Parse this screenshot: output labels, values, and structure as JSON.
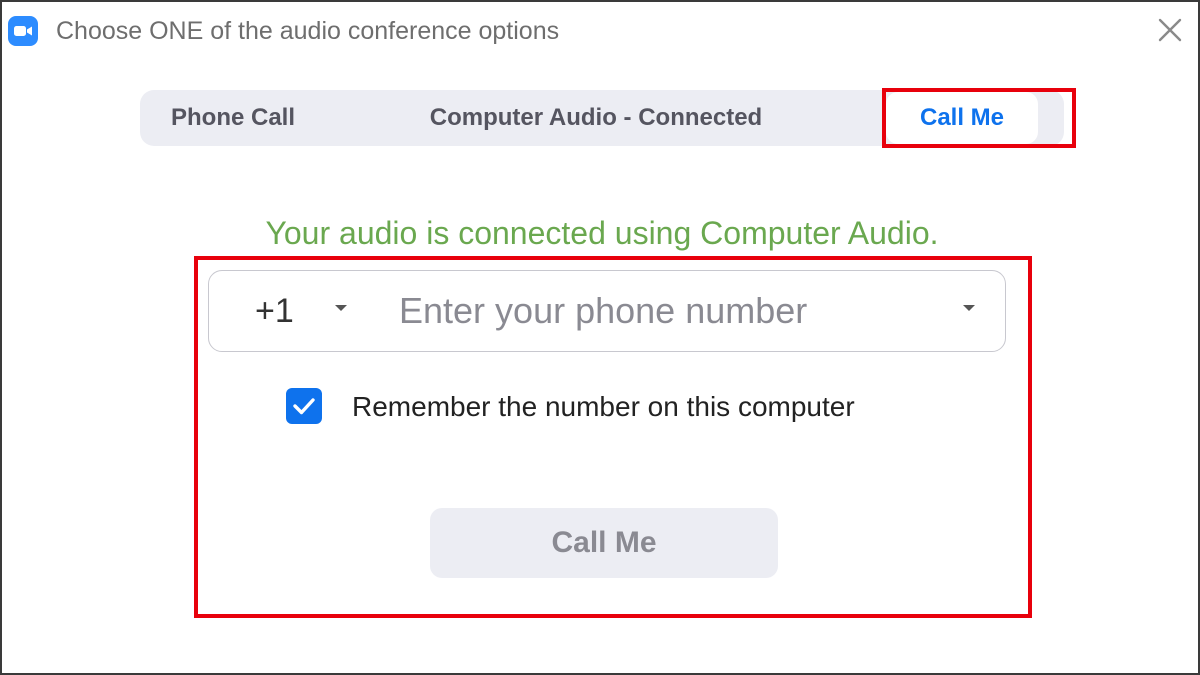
{
  "window": {
    "title": "Choose ONE of the audio conference options",
    "app_icon": "zoom-camera-icon",
    "close_icon": "close-icon"
  },
  "tabs": [
    {
      "label": "Phone Call",
      "selected": false
    },
    {
      "label": "Computer Audio - Connected",
      "selected": false
    },
    {
      "label": "Call Me",
      "selected": true
    }
  ],
  "status": {
    "text": "Your audio is connected using Computer Audio.",
    "color": "#6aa84f"
  },
  "phone": {
    "country_code": "+1",
    "placeholder": "Enter your phone number",
    "value": ""
  },
  "remember": {
    "label": "Remember the number on this computer",
    "checked": true
  },
  "call_button": {
    "label": "Call Me",
    "enabled": false
  },
  "colors": {
    "accent": "#0e72ed",
    "highlight": "#e8000c",
    "status_green": "#6aa84f"
  }
}
